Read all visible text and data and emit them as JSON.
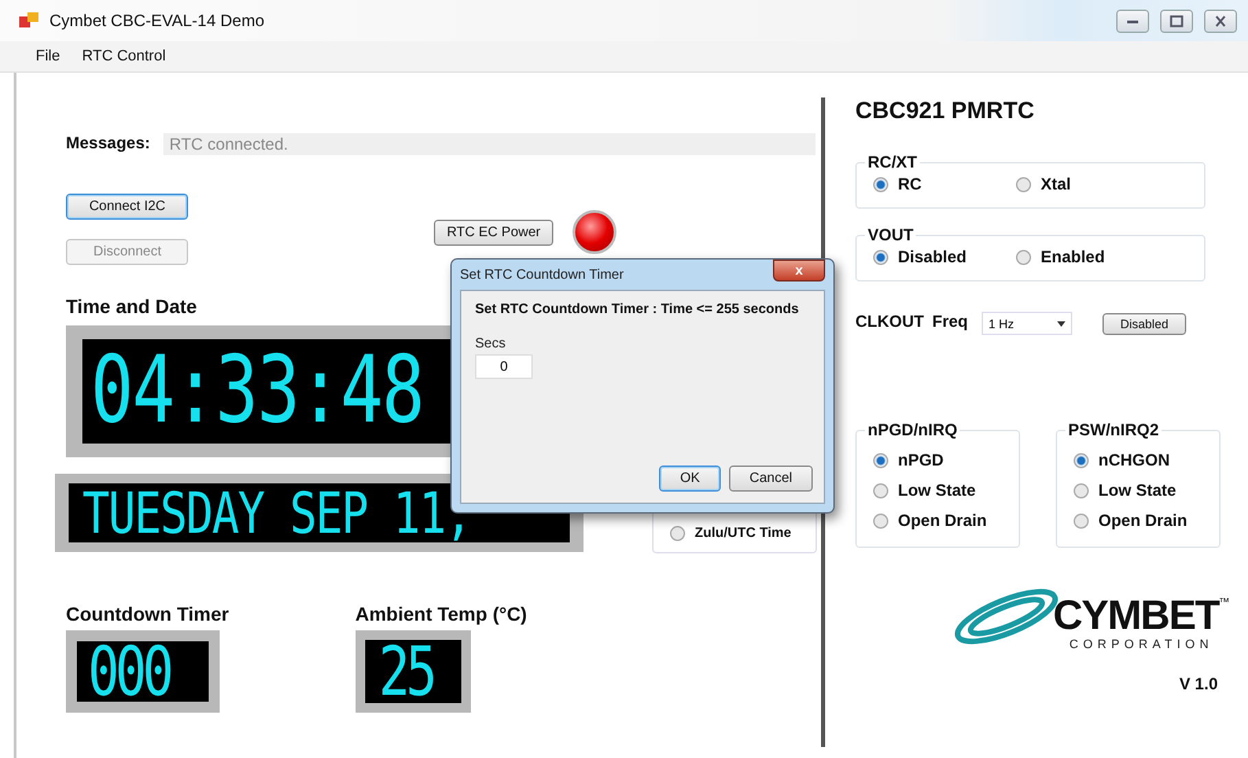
{
  "window": {
    "title": "Cymbet CBC-EVAL-14 Demo"
  },
  "menu": [
    {
      "label": "File"
    },
    {
      "label": "RTC Control"
    }
  ],
  "messages": {
    "label": "Messages:",
    "value": "RTC connected."
  },
  "connect_button": {
    "label": "Connect I2C",
    "disabled": false
  },
  "disconnect_button": {
    "label": "Disconnect",
    "disabled": true
  },
  "power": {
    "label": "RTC EC  Power",
    "lit": true
  },
  "time_and_date": {
    "title": "Time and Date",
    "time": "04:33:48",
    "date": "TUESDAY SEP 11,"
  },
  "time_mode": {
    "label": "Zulu/UTC Time",
    "selected": false
  },
  "countdown": {
    "title": "Countdown Timer",
    "value": "000"
  },
  "ambient": {
    "title": "Ambient Temp (°C)",
    "value": "25"
  },
  "device": {
    "title": "CBC921 PMRTC"
  },
  "groups": [
    {
      "kind": "row",
      "title": "RC/XT",
      "options": [
        {
          "label": "RC",
          "selected": true
        },
        {
          "label": "Xtal",
          "selected": false
        }
      ]
    },
    {
      "kind": "row",
      "title": "VOUT",
      "options": [
        {
          "label": "Disabled",
          "selected": true
        },
        {
          "label": "Enabled",
          "selected": false
        }
      ]
    }
  ],
  "clkout": {
    "label": "CLKOUT",
    "freq_label": "Freq",
    "freq": "1 Hz",
    "button": "Disabled"
  },
  "pin_groups": [
    {
      "kind": "column",
      "title": "nPGD/nIRQ",
      "options": [
        {
          "label": "nPGD",
          "selected": true
        },
        {
          "label": "Low State",
          "selected": false
        },
        {
          "label": "Open Drain",
          "selected": false
        }
      ]
    },
    {
      "kind": "column",
      "title": "PSW/nIRQ2",
      "options": [
        {
          "label": "nCHGON",
          "selected": true
        },
        {
          "label": "Low State",
          "selected": false
        },
        {
          "label": "Open Drain",
          "selected": false
        }
      ]
    }
  ],
  "logo": {
    "name": "CYMBET",
    "mark": "™",
    "sub": "CORPORATION"
  },
  "version": "V 1.0",
  "dialog": {
    "title": "Set RTC Countdown Timer",
    "close": "x",
    "message": "Set RTC Countdown Timer : Time <= 255 seconds",
    "field_label": "Secs",
    "value": "0",
    "buttons": [
      {
        "label": "OK",
        "default": true
      },
      {
        "label": "Cancel",
        "default": false
      }
    ]
  }
}
